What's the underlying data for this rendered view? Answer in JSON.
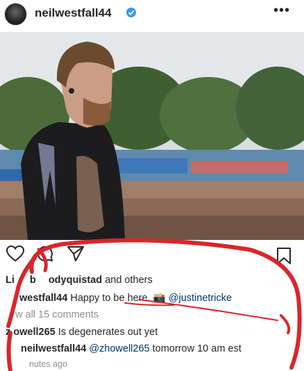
{
  "post": {
    "username": "neilwestfall44",
    "more_label": "•••"
  },
  "likes": {
    "prefix": "Li",
    "middle": "b",
    "user": "odyquistad",
    "suffix": "and others"
  },
  "caption": {
    "user": "westfall44",
    "text": "Happy to be here.",
    "emoji": "📸",
    "mention": "@justinetricke"
  },
  "view_comments": "w all 15 comments",
  "comments": [
    {
      "user": "z owell265",
      "text": "Is degenerates out yet"
    },
    {
      "user": "neilwestfall44",
      "mention": "@zhowell265",
      "text": "tomorrow 10 am est"
    }
  ],
  "timestamp": "nutes ago",
  "colors": {
    "verified": "#3897f0",
    "annotation": "#d9262b",
    "muted": "#8e8e8e"
  }
}
